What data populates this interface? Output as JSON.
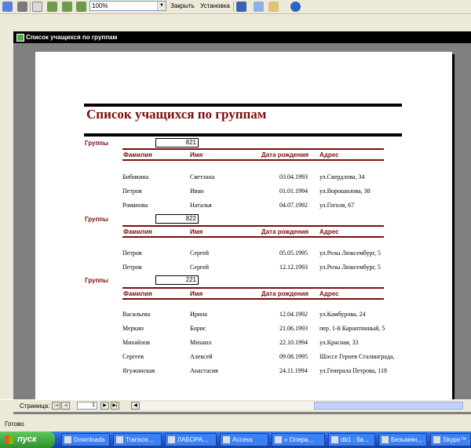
{
  "toolbar": {
    "zoom_value": "100%",
    "close_label": "Закрыть",
    "setup_label": "Установка"
  },
  "window": {
    "title": "Список учащихся по группам"
  },
  "report": {
    "title": "Список учащихся по группам",
    "group_label": "Группы",
    "headers": {
      "surname": "Фамилия",
      "name": "Имя",
      "birth": "Дата рождения",
      "address": "Адрес"
    },
    "groups": [
      {
        "number": "821",
        "rows": [
          [
            "Бибикина",
            "Светлана",
            "03.04.1993",
            "ул.Свердлова, 34"
          ],
          [
            "Петров",
            "Иван",
            "01.01.1994",
            "ул.Ворошилова, 38"
          ],
          [
            "Романова",
            "Наталья",
            "04.07.1992",
            "ул.Гоголя, 67"
          ]
        ]
      },
      {
        "number": "822",
        "rows": [
          [
            "Петров",
            "Сергей",
            "05.05.1995",
            "ул.Розы Люксембург, 5"
          ],
          [
            "Петров",
            "Сергей",
            "12.12.1993",
            "ул.Розы Люксембург, 5"
          ]
        ]
      },
      {
        "number": "221",
        "rows": [
          [
            "Васильева",
            "Ирина",
            "12.04.1992",
            "ул.Камбурова, 24"
          ],
          [
            "Меркин",
            "Борис",
            "21.06.1993",
            "пер. 1-й Карантинный, 5"
          ],
          [
            "Михайлов",
            "Михаил",
            "22.10.1994",
            "ул.Красная, 33"
          ],
          [
            "Сергеев",
            "Алексей",
            "09.08.1995",
            "Шоссе Героев Сталинграда,"
          ],
          [
            "Ягужинская",
            "Анастасия",
            "24.11.1994",
            "ул.Генерала Петрова, 118"
          ]
        ]
      }
    ]
  },
  "navigation": {
    "page_label": "Страница:",
    "page_value": "1"
  },
  "status": {
    "text": "Готово"
  },
  "taskbar": {
    "start_label": "пуск",
    "tasks": [
      "Downloads",
      "Transce...",
      "ЛАБОРА...",
      "Access",
      "» Опера...",
      "db1 : ба...",
      "Безымян...",
      "Skype™ ..."
    ]
  }
}
